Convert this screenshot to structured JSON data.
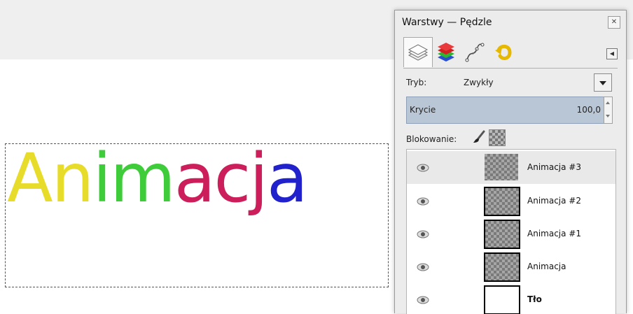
{
  "canvas": {
    "letters": [
      {
        "ch": "A",
        "color": "#e8dc2a"
      },
      {
        "ch": "n",
        "color": "#e8dc2a"
      },
      {
        "ch": "i",
        "color": "#3fcc3a"
      },
      {
        "ch": "m",
        "color": "#3fcc3a"
      },
      {
        "ch": "a",
        "color": "#cc1e5a"
      },
      {
        "ch": "c",
        "color": "#cc1e5a"
      },
      {
        "ch": "j",
        "color": "#cc1e5a"
      },
      {
        "ch": "a",
        "color": "#2222cc"
      }
    ]
  },
  "panel": {
    "title": "Warstwy — Pędzle",
    "close_icon": "close-icon",
    "tabs": [
      {
        "icon": "layers-icon"
      },
      {
        "icon": "channels-icon"
      },
      {
        "icon": "paths-icon"
      },
      {
        "icon": "undo-history-icon"
      }
    ],
    "mode": {
      "label": "Tryb:",
      "value": "Zwykły"
    },
    "opacity": {
      "label": "Krycie",
      "value": "100,0"
    },
    "lock": {
      "label": "Blokowanie:"
    },
    "layers": [
      {
        "name": "Animacja #3",
        "selected": true
      },
      {
        "name": "Animacja #2"
      },
      {
        "name": "Animacja #1"
      },
      {
        "name": "Animacja"
      },
      {
        "name": "Tło"
      }
    ],
    "accent_color": "#b9c6d6"
  }
}
